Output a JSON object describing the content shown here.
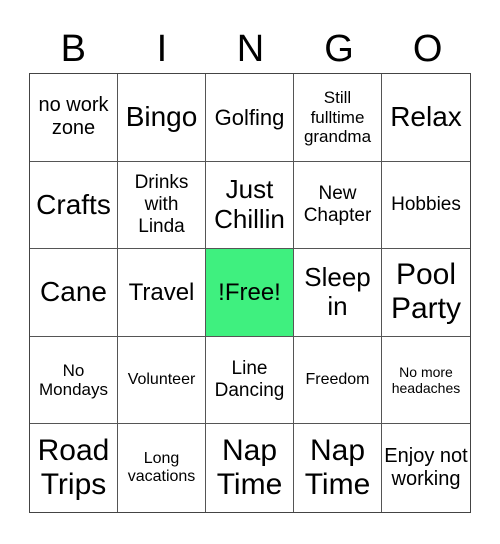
{
  "header": [
    "B",
    "I",
    "N",
    "G",
    "O"
  ],
  "free_color": "#3ff07f",
  "cells": [
    [
      "no work zone",
      "Bingo",
      "Golfing",
      "Still fulltime grandma",
      "Relax"
    ],
    [
      "Crafts",
      "Drinks with Linda",
      "Just Chillin",
      "New Chapter",
      "Hobbies"
    ],
    [
      "Cane",
      "Travel",
      "!Free!",
      "Sleep in",
      "Pool Party"
    ],
    [
      "No Mondays",
      "Volunteer",
      "Line Dancing",
      "Freedom",
      "No more headaches"
    ],
    [
      "Road Trips",
      "Long vacations",
      "Nap Time",
      "Nap Time",
      "Enjoy not working"
    ]
  ]
}
